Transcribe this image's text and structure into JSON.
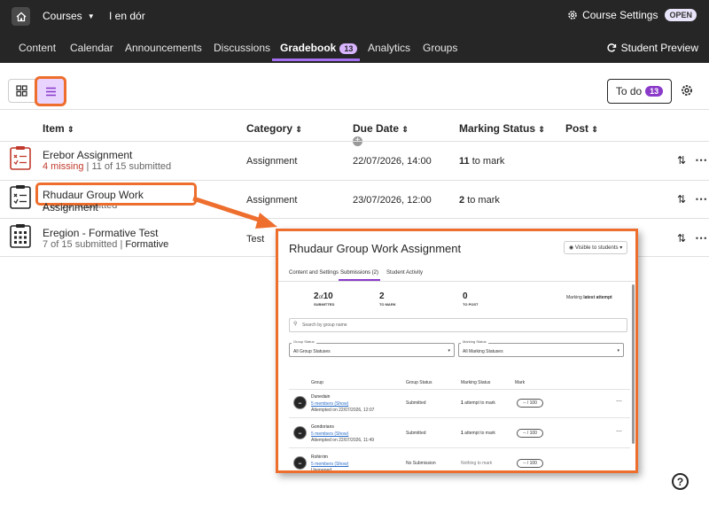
{
  "topbar": {
    "courses_label": "Courses",
    "course_name": "I en dór",
    "settings_label": "Course Settings",
    "open_badge": "OPEN"
  },
  "nav": {
    "items": [
      "Content",
      "Calendar",
      "Announcements",
      "Discussions",
      "Gradebook",
      "Analytics",
      "Groups"
    ],
    "gradebook_badge": "13",
    "active": "Gradebook",
    "student_preview": "Student Preview"
  },
  "toolbar": {
    "todo_label": "To do",
    "todo_count": "13"
  },
  "table": {
    "headers": [
      "Item",
      "Category",
      "Due Date",
      "Marking Status",
      "Post"
    ],
    "rows": [
      {
        "title": "Erebor Assignment",
        "missing": "4 missing",
        "separator": "|",
        "submitted": "11 of 15 submitted",
        "category": "Assignment",
        "due": "22/07/2026, 14:00",
        "mark_count": "11",
        "mark_text": "to mark"
      },
      {
        "title": "Rhudaur Group Work Assignment",
        "submitted": "2 of 10 submitted",
        "category": "Assignment",
        "due": "23/07/2026, 12:00",
        "mark_count": "2",
        "mark_text": "to mark"
      },
      {
        "title": "Eregion - Formative Test",
        "submitted": "7 of 15 submitted",
        "separator": "|",
        "type": "Formative",
        "category": "Test"
      }
    ]
  },
  "callout": {
    "title": "Rhudaur Group Work Assignment",
    "visibility": "Visible to students",
    "tabs": [
      "Content and Settings",
      "Submissions (2)",
      "Student Activity"
    ],
    "stats": {
      "submitted_num": "2",
      "submitted_of": "of",
      "submitted_total": "10",
      "submitted_label": "SUBMITTED",
      "to_mark_num": "2",
      "to_mark_label": "TO MARK",
      "to_post_num": "0",
      "to_post_label": "TO POST",
      "marking_prefix": "Marking",
      "marking_value": "latest attempt"
    },
    "search_placeholder": "Search by group name",
    "filters": {
      "group_status_label": "Group Status",
      "group_status_value": "All Group Statuses",
      "marking_status_label": "Marking Status",
      "marking_status_value": "All Marking Statuses"
    },
    "columns": [
      "Group",
      "Group Status",
      "Marking Status",
      "Mark"
    ],
    "groups": [
      {
        "name": "Dunedain",
        "members": "5 members (Show)",
        "attempt": "Attempted on 22/07/2026, 12:07",
        "status": "Submitted",
        "marking_num": "1",
        "marking": "attempt to mark",
        "mark": "-- / 100"
      },
      {
        "name": "Gondorians",
        "members": "5 members (Show)",
        "attempt": "Attempted on 22/07/2026, 11:49",
        "status": "Submitted",
        "marking_num": "1",
        "marking": "attempt to mark",
        "mark": "-- / 100"
      },
      {
        "name": "Rohirrim",
        "members": "5 members (Show)",
        "attempt": "Unopened",
        "status": "No Submission",
        "marking": "Nothing to mark",
        "mark": "-- / 100"
      }
    ]
  },
  "colors": {
    "topbar_bg": "#262626",
    "accent_purple": "#8a3ac9",
    "highlight_orange": "#ee6e2d",
    "missing_red": "#c0392b"
  }
}
